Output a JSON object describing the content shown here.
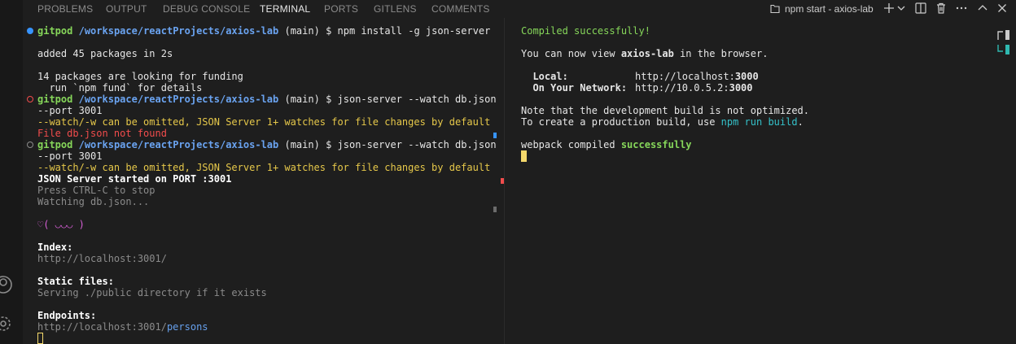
{
  "tabs": [
    {
      "label": "PROBLEMS"
    },
    {
      "label": "OUTPUT"
    },
    {
      "label": "DEBUG CONSOLE"
    },
    {
      "label": "TERMINAL"
    },
    {
      "label": "PORTS"
    },
    {
      "label": "GITLENS"
    },
    {
      "label": "COMMENTS"
    }
  ],
  "terminal_title": "npm start - axios-lab",
  "icons": [
    "terminal-icon",
    "add-icon",
    "chevron-down-icon",
    "split-icon",
    "trash-icon",
    "more-icon",
    "chevron-up-icon",
    "close-icon",
    "account-icon",
    "settings-icon"
  ],
  "left_terminal": {
    "cmd1": {
      "user": "gitpod",
      "path": "/workspace/reactProjects/axios-lab",
      "branch": "(main)",
      "prompt": "$",
      "command": "npm install -g json-server"
    },
    "added": "added 45 packages in 2s",
    "funding1": "14 packages are looking for funding",
    "funding2": "  run `npm fund` for details",
    "cmd2": {
      "user": "gitpod",
      "path": "/workspace/reactProjects/axios-lab",
      "branch": "(main)",
      "prompt": "$",
      "command": "json-server --watch db.json",
      "wrap": "--port 3001"
    },
    "warn1": "--watch/-w can be omitted, JSON Server 1+ watches for file changes by default",
    "error1": "File db.json not found",
    "cmd3": {
      "user": "gitpod",
      "path": "/workspace/reactProjects/axios-lab",
      "branch": "(main)",
      "prompt": "$",
      "command": "json-server --watch db.json",
      "wrap": "--port 3001"
    },
    "warn2": "--watch/-w can be omitted, JSON Server 1+ watches for file changes by default",
    "started": "JSON Server started on PORT :3001",
    "press": "Press CTRL-C to stop",
    "watching": "Watching db.json...",
    "emoji": "♡( ◡◡◡ )",
    "index_label": "Index:",
    "index_url": "http://localhost:3001/",
    "static_label": "Static files:",
    "static_text": "Serving ./public directory if it exists",
    "endpoints_label": "Endpoints:",
    "endpoint_base": "http://localhost:3001/",
    "endpoint_path": "persons"
  },
  "right_terminal": {
    "compiled": "Compiled successfully!",
    "view_pre": "You can now view ",
    "view_app": "axios-lab",
    "view_post": " in the browser.",
    "local_label": "  Local:",
    "local_url_pre": "http://localhost:",
    "local_port": "3000",
    "network_label": "  On Your Network:",
    "network_url_pre": "http://10.0.5.2:",
    "network_port": "3000",
    "note1": "Note that the development build is not optimized.",
    "note2_pre": "To create a production build, use ",
    "note2_cmd": "npm run build",
    "note2_post": ".",
    "webpack_pre": "webpack compiled ",
    "webpack_status": "successfully"
  },
  "colors": {
    "background": "#1e1e1e",
    "green": "#86d65a",
    "blue": "#67a1ee",
    "yellow": "#e6c84a",
    "red": "#f14c4c",
    "cyan": "#34c0c8",
    "cursor": "#f5d96b"
  }
}
